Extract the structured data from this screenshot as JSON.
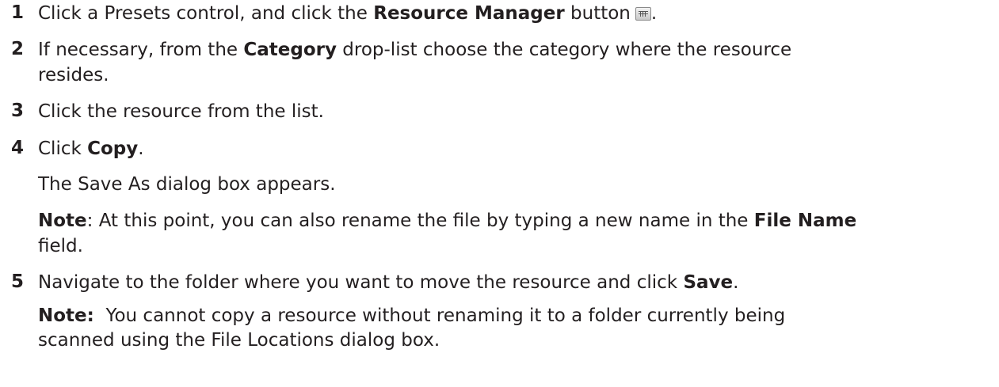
{
  "steps": [
    {
      "num": "1",
      "lines": [
        {
          "t1": "Click a Presets control, and click the ",
          "b1": "Resource Manager",
          "t2": " button",
          "t3": "."
        }
      ]
    },
    {
      "num": "2",
      "lines": [
        {
          "t1": "If necessary, from the ",
          "b1": "Category",
          "t2": " drop-list choose the category where the resource"
        },
        {
          "t1": "resides."
        }
      ]
    },
    {
      "num": "3",
      "lines": [
        {
          "t1": "Click the resource from the list."
        }
      ]
    },
    {
      "num": "4",
      "lines": [
        {
          "t1": "Click ",
          "b1": "Copy",
          "t2": "."
        },
        {
          "t1": "The Save As dialog box appears."
        },
        {
          "b1": "Note",
          "t2": ": At this point, you can also rename the file by typing a new name in the ",
          "b2": "File Name"
        },
        {
          "t1": "field."
        }
      ]
    },
    {
      "num": "5",
      "lines": [
        {
          "t1": "Navigate to the folder where you want to move the resource and click ",
          "b1": "Save",
          "t2": "."
        },
        {
          "b1": "Note:",
          "t2": "  You cannot copy a resource without renaming it to a folder currently being"
        },
        {
          "t1": "scanned using the File Locations dialog box."
        }
      ]
    }
  ],
  "icons": {
    "resource_manager_button": "resource-manager-icon"
  }
}
